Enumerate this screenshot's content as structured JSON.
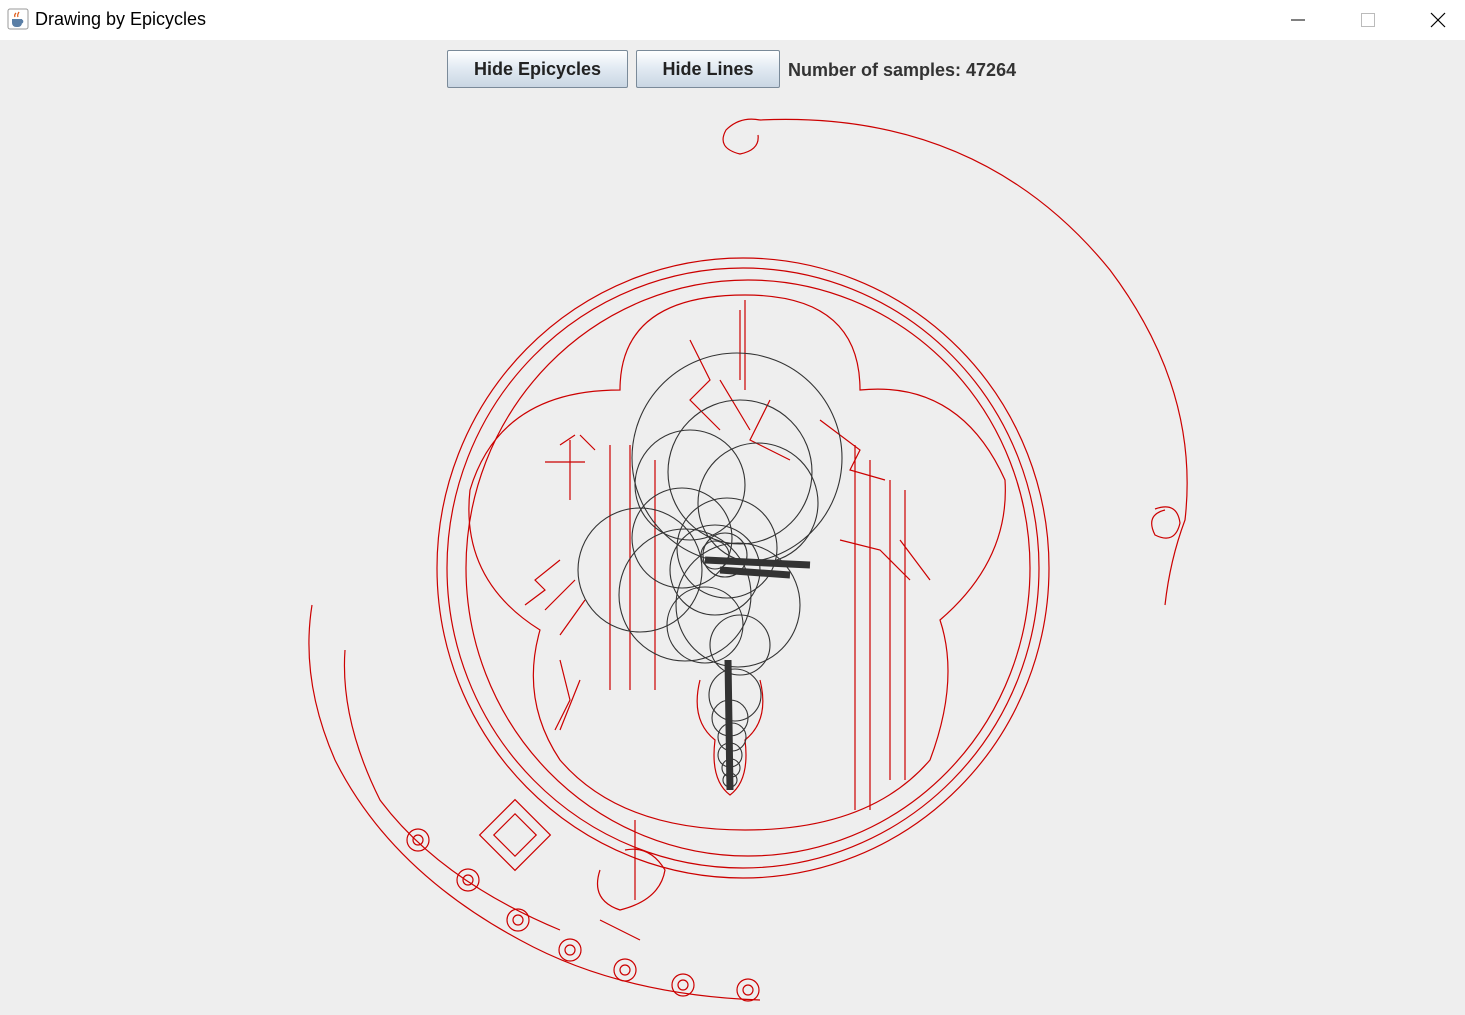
{
  "window": {
    "title": "Drawing by Epicycles",
    "controls": [
      "minimize",
      "maximize",
      "close"
    ]
  },
  "toolbar": {
    "hide_epicycles_label": "Hide Epicycles",
    "hide_lines_label": "Hide Lines",
    "samples_label": "Number of samples: 47264"
  },
  "colors": {
    "drawing_line": "#cc0000",
    "epicycle": "#333333",
    "background": "#eeeeee"
  },
  "icons": {
    "app": "java-cup-icon",
    "minimize": "minimize-icon",
    "maximize": "maximize-icon",
    "close": "close-icon"
  }
}
